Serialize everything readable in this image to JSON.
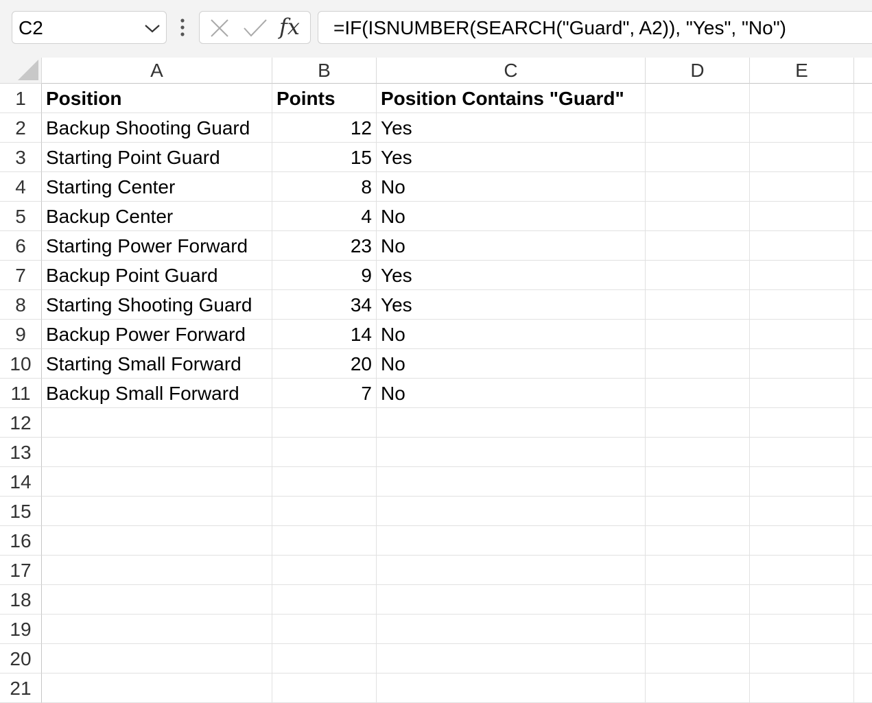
{
  "name_box": {
    "value": "C2"
  },
  "formula_bar": {
    "fx_label": "fx",
    "formula": "=IF(ISNUMBER(SEARCH(\"Guard\", A2)), \"Yes\", \"No\")"
  },
  "columns": [
    "A",
    "B",
    "C",
    "D",
    "E"
  ],
  "row_numbers": [
    "1",
    "2",
    "3",
    "4",
    "5",
    "6",
    "7",
    "8",
    "9",
    "10",
    "11",
    "12",
    "13",
    "14",
    "15",
    "16",
    "17",
    "18",
    "19",
    "20",
    "21"
  ],
  "header_row": {
    "a": "Position",
    "b": "Points",
    "c": "Position Contains \"Guard\""
  },
  "rows": [
    {
      "a": "Backup Shooting Guard",
      "b": "12",
      "c": "Yes"
    },
    {
      "a": "Starting Point Guard",
      "b": "15",
      "c": "Yes"
    },
    {
      "a": "Starting Center",
      "b": "8",
      "c": "No"
    },
    {
      "a": "Backup Center",
      "b": "4",
      "c": "No"
    },
    {
      "a": "Starting Power Forward",
      "b": "23",
      "c": "No"
    },
    {
      "a": "Backup Point Guard",
      "b": "9",
      "c": "Yes"
    },
    {
      "a": "Starting Shooting Guard",
      "b": "34",
      "c": "Yes"
    },
    {
      "a": "Backup Power Forward",
      "b": "14",
      "c": "No"
    },
    {
      "a": "Starting Small Forward",
      "b": "20",
      "c": "No"
    },
    {
      "a": "Backup Small Forward",
      "b": "7",
      "c": "No"
    }
  ]
}
